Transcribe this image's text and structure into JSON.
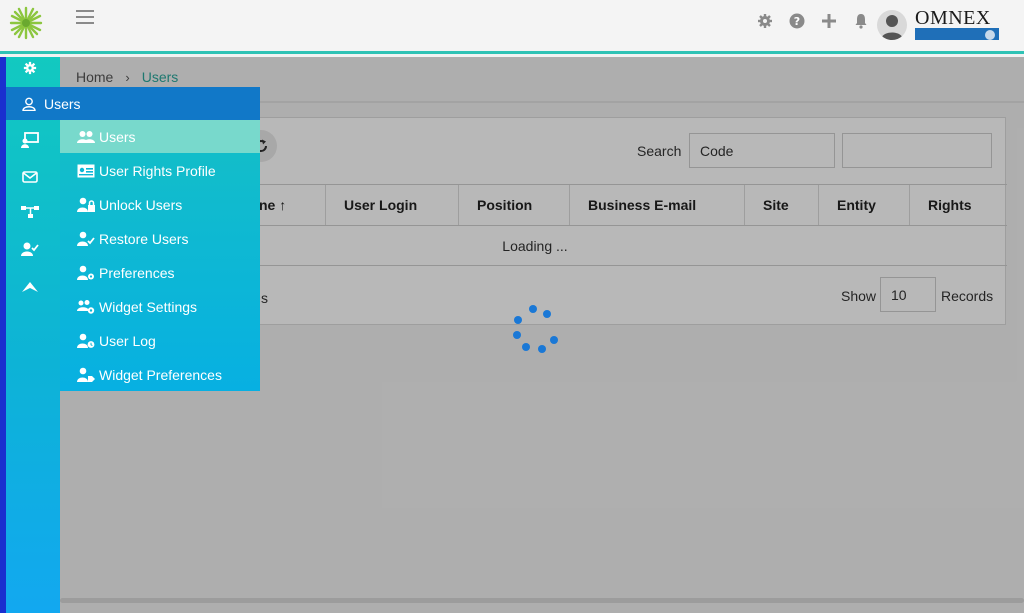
{
  "header": {
    "brand": "OMNEX",
    "icons": [
      "settings-icon",
      "help-icon",
      "add-icon",
      "bell-icon"
    ]
  },
  "rail": {
    "icons": [
      "gear-icon",
      "user-icon",
      "computer-user-icon",
      "mail-icon",
      "network-icon",
      "user-check-icon",
      "paper-plane-icon"
    ]
  },
  "breadcrumb": {
    "home": "Home",
    "separator": "›",
    "current": "Users"
  },
  "toolbar": {
    "search_label": "Search",
    "search_value": "Code"
  },
  "table": {
    "columns": [
      "ne ↑",
      "User Login",
      "Position",
      "Business E-mail",
      "Site",
      "Entity",
      "Rights"
    ],
    "loading_text": "Loading ..."
  },
  "footer": {
    "partial_text": "s",
    "show_label": "Show",
    "page_size": "10",
    "records_label": "Records"
  },
  "menu": {
    "section_label": "Users",
    "items": [
      {
        "label": "Users",
        "icon": "users-icon",
        "active": true
      },
      {
        "label": "User Rights Profile",
        "icon": "id-card-icon",
        "active": false
      },
      {
        "label": "Unlock Users",
        "icon": "user-lock-icon",
        "active": false
      },
      {
        "label": "Restore Users",
        "icon": "user-restore-icon",
        "active": false
      },
      {
        "label": "Preferences",
        "icon": "user-gear-icon",
        "active": false
      },
      {
        "label": "Widget Settings",
        "icon": "users-gear-icon",
        "active": false
      },
      {
        "label": "User Log",
        "icon": "user-clock-icon",
        "active": false
      },
      {
        "label": "Widget Preferences",
        "icon": "user-tag-icon",
        "active": false
      }
    ]
  },
  "colors": {
    "accent": "#2fc2b5",
    "menu_head": "#1178c8",
    "menu_active": "#78d9cc",
    "spinner": "#1a78d6"
  }
}
